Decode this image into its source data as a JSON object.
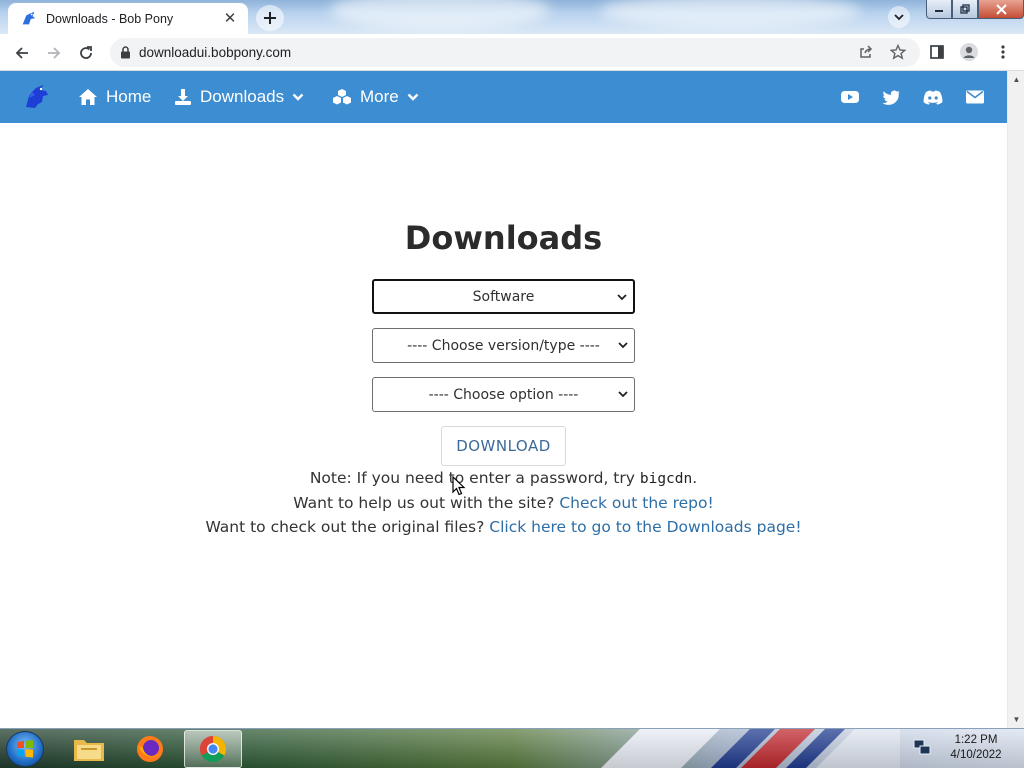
{
  "browser": {
    "tab_title": "Downloads - Bob Pony",
    "url": "downloadui.bobpony.com"
  },
  "site_nav": {
    "home_label": "Home",
    "downloads_label": "Downloads",
    "more_label": "More",
    "social_icons": [
      "youtube-icon",
      "twitter-icon",
      "discord-icon",
      "mail-icon"
    ]
  },
  "page": {
    "heading": "Downloads",
    "select_category": "Software",
    "select_version": "---- Choose version/type ----",
    "select_option": "---- Choose option ----",
    "download_button": "DOWNLOAD",
    "note_prefix": "Note: If you need to enter a password, try ",
    "note_code": "bigcdn",
    "note_suffix": ".",
    "help_prefix": "Want to help us out with the site? ",
    "help_link": "Check out the repo!",
    "files_prefix": "Want to check out the original files? ",
    "files_link": "Click here to go to the Downloads page!"
  },
  "taskbar": {
    "time": "1:22 PM",
    "date": "4/10/2022"
  },
  "colors": {
    "nav_blue": "#3c8dd2",
    "link_blue": "#2e6ea6"
  }
}
